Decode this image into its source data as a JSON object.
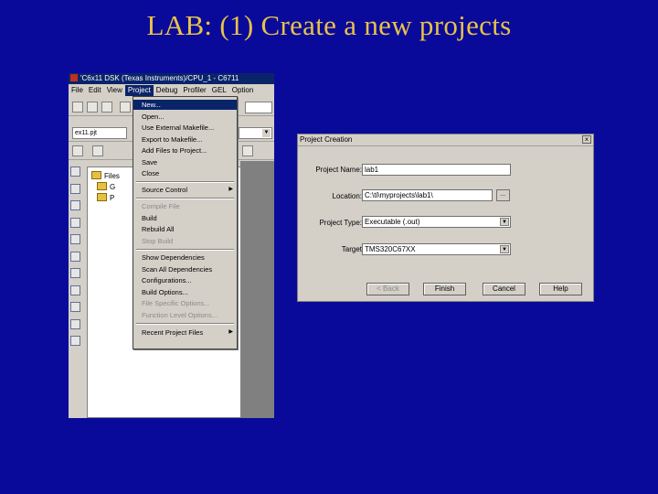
{
  "slide": {
    "title": "LAB:  (1) Create a new projects"
  },
  "ide": {
    "window_title": "'C6x11 DSK (Texas Instruments)/CPU_1 - C6711",
    "menubar": [
      "File",
      "Edit",
      "View",
      "Project",
      "Debug",
      "Profiler",
      "GEL",
      "Option"
    ],
    "active_menu": "Project",
    "toolbar_combo": "ex11.pjt",
    "file_tree": {
      "root": "Files",
      "items": [
        "G",
        "P"
      ]
    },
    "project_menu": [
      {
        "label": "New...",
        "state": "selected"
      },
      {
        "label": "Open...",
        "state": "normal"
      },
      {
        "label": "Use External Makefile...",
        "state": "normal"
      },
      {
        "label": "Export to Makefile...",
        "state": "normal"
      },
      {
        "label": "Add Files to Project...",
        "state": "normal"
      },
      {
        "label": "Save",
        "state": "normal"
      },
      {
        "label": "Close",
        "state": "normal"
      },
      {
        "label": "Source Control",
        "state": "normal",
        "submenu": true
      },
      {
        "label": "Compile File",
        "state": "disabled"
      },
      {
        "label": "Build",
        "state": "normal"
      },
      {
        "label": "Rebuild All",
        "state": "normal"
      },
      {
        "label": "Stop Build",
        "state": "disabled"
      },
      {
        "label": "Show Dependencies",
        "state": "normal"
      },
      {
        "label": "Scan All Dependencies",
        "state": "normal"
      },
      {
        "label": "Configurations...",
        "state": "normal"
      },
      {
        "label": "Build Options...",
        "state": "normal"
      },
      {
        "label": "File Specific Options...",
        "state": "disabled"
      },
      {
        "label": "Function Level Options...",
        "state": "disabled"
      },
      {
        "label": "Recent Project Files",
        "state": "normal",
        "submenu": true
      }
    ]
  },
  "dialog": {
    "title": "Project Creation",
    "fields": {
      "project_name": {
        "label": "Project Name:",
        "value": "lab1"
      },
      "location": {
        "label": "Location:",
        "value": "C:\\ti\\myprojects\\lab1\\"
      },
      "project_type": {
        "label": "Project Type:",
        "value": "Executable (.out)"
      },
      "target": {
        "label": "Target",
        "value": "TMS320C67XX"
      }
    },
    "browse_label": "...",
    "buttons": {
      "back": "< Back",
      "finish": "Finish",
      "cancel": "Cancel",
      "help": "Help"
    }
  },
  "colors": {
    "background": "#0a0a9a",
    "title": "#e8c24a",
    "selection": "#0a246a",
    "window": "#d4d0c8"
  }
}
